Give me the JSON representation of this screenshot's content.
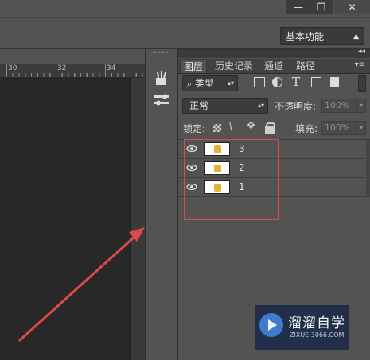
{
  "window": {
    "minimize_label": "—",
    "restore_label": "❐",
    "close_label": "✕"
  },
  "workspace": {
    "selected": "基本功能"
  },
  "ruler": {
    "labels": [
      "30",
      "32",
      "34"
    ]
  },
  "tools": {
    "icons": [
      "brush-tool-icon",
      "adjust-tool-icon"
    ]
  },
  "panel": {
    "collapse_label": "◂◂",
    "menu_label": "▾≡",
    "tabs": [
      {
        "label": "图层",
        "active": true
      },
      {
        "label": "历史记录",
        "active": false
      },
      {
        "label": "通道",
        "active": false
      },
      {
        "label": "路径",
        "active": false
      }
    ],
    "filter": {
      "label": "类型"
    },
    "filter_icons": [
      "image-filter-icon",
      "adjustment-filter-icon",
      "text-filter-icon",
      "shape-filter-icon",
      "smart-object-filter-icon"
    ],
    "blend_mode": "正常",
    "opacity_label": "不透明度:",
    "opacity_value": "100%",
    "lock_label": "锁定:",
    "fill_label": "填充:",
    "fill_value": "100%",
    "layers": [
      {
        "name": "3",
        "visible": true
      },
      {
        "name": "2",
        "visible": true
      },
      {
        "name": "1",
        "visible": true
      }
    ]
  },
  "watermark": {
    "title": "溜溜自学",
    "url": "ZIXUE.3066.COM"
  },
  "colors": {
    "annotation": "#e0494b",
    "panel_bg": "#535353",
    "canvas_bg": "#282828"
  }
}
